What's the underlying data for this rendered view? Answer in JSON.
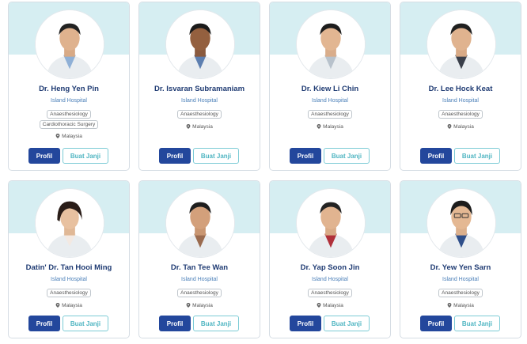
{
  "colors": {
    "band": "#d6eef2",
    "name": "#1f3b73",
    "hospital": "#4a7fb8",
    "profil_button": "#23479c",
    "janji_button_text": "#4fb5c2"
  },
  "doctors": [
    {
      "name": "Dr. Heng Yen Pin",
      "hospital": "Island Hospital",
      "specialties": [
        "Anaesthesiology",
        "Cardiothoracic Surgery"
      ],
      "location": "Malaysia",
      "profil_label": "Profil",
      "janji_label": "Buat Janji",
      "photo_icon": "doctor-portrait-icon"
    },
    {
      "name": "Dr. Isvaran Subramaniam",
      "hospital": "Island Hospital",
      "specialties": [
        "Anaesthesiology"
      ],
      "location": "Malaysia",
      "profil_label": "Profil",
      "janji_label": "Buat Janji",
      "photo_icon": "doctor-portrait-icon"
    },
    {
      "name": "Dr. Kiew Li Chin",
      "hospital": "Island Hospital",
      "specialties": [
        "Anaesthesiology"
      ],
      "location": "Malaysia",
      "profil_label": "Profil",
      "janji_label": "Buat Janji",
      "photo_icon": "doctor-portrait-icon"
    },
    {
      "name": "Dr. Lee Hock Keat",
      "hospital": "Island Hospital",
      "specialties": [
        "Anaesthesiology"
      ],
      "location": "Malaysia",
      "profil_label": "Profil",
      "janji_label": "Buat Janji",
      "photo_icon": "doctor-portrait-icon"
    },
    {
      "name": "Datin' Dr. Tan Hooi Ming",
      "hospital": "Island Hospital",
      "specialties": [
        "Anaesthesiology"
      ],
      "location": "Malaysia",
      "profil_label": "Profil",
      "janji_label": "Buat Janji",
      "photo_icon": "doctor-portrait-icon"
    },
    {
      "name": "Dr. Tan Tee Wan",
      "hospital": "Island Hospital",
      "specialties": [
        "Anaesthesiology"
      ],
      "location": "Malaysia",
      "profil_label": "Profil",
      "janji_label": "Buat Janji",
      "photo_icon": "doctor-portrait-icon"
    },
    {
      "name": "Dr. Yap Soon Jin",
      "hospital": "Island Hospital",
      "specialties": [
        "Anaesthesiology"
      ],
      "location": "Malaysia",
      "profil_label": "Profil",
      "janji_label": "Buat Janji",
      "photo_icon": "doctor-portrait-icon"
    },
    {
      "name": "Dr. Yew Yen Sarn",
      "hospital": "Island Hospital",
      "specialties": [
        "Anaesthesiology"
      ],
      "location": "Malaysia",
      "profil_label": "Profil",
      "janji_label": "Buat Janji",
      "photo_icon": "doctor-portrait-icon"
    }
  ]
}
